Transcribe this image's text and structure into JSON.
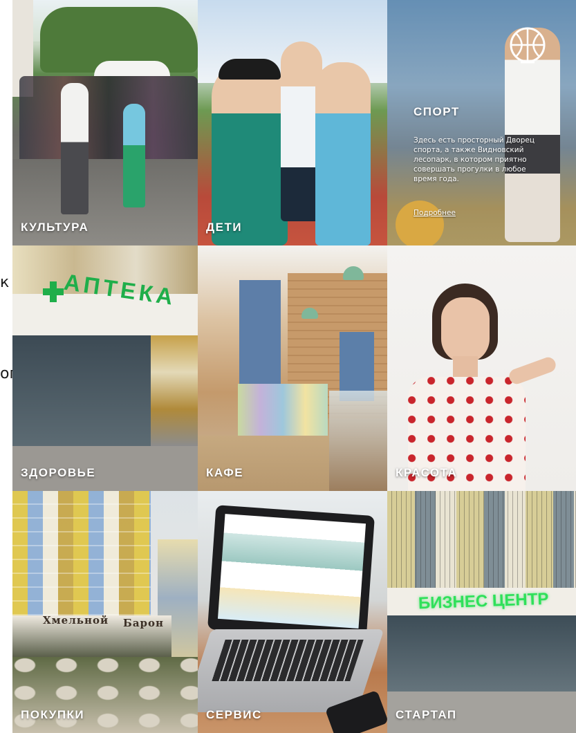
{
  "stray_text": {
    "fragment_a": "к",
    "fragment_b": "ого"
  },
  "tiles": [
    {
      "label": "КУЛЬТУРА"
    },
    {
      "label": "ДЕТИ"
    },
    {
      "label": "СПОРТ"
    },
    {
      "label": "ЗДОРОВЬЕ"
    },
    {
      "label": "КАФЕ"
    },
    {
      "label": "КРАСОТА"
    },
    {
      "label": "ПОКУПКИ"
    },
    {
      "label": "СЕРВИС"
    },
    {
      "label": "СТАРТАП"
    }
  ],
  "sport": {
    "description": "Здесь есть просторный Дворец спорта, а также Видновский лесопарк, в котором приятно совершать прогулки в любое время года.",
    "more_link": "Подробнее",
    "icon": "basketball-icon"
  },
  "signs": {
    "pharmacy": "АПТЕКА",
    "business": "БИЗНЕС ЦЕНТР",
    "shop": "Хмельной",
    "shop2": "Барон"
  },
  "colors": {
    "label_text": "#ffffff",
    "pharmacy_green": "#1fae4a",
    "business_green": "#2fe05a"
  }
}
